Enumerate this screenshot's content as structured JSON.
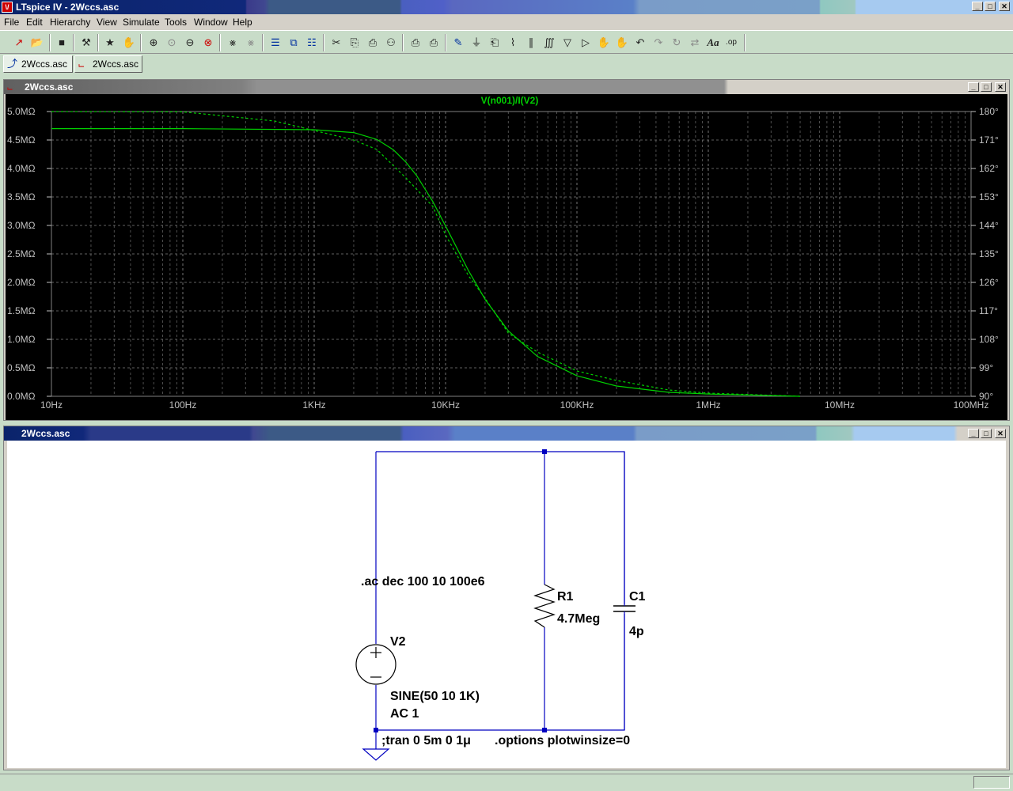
{
  "app": {
    "title": "LTspice IV - 2Wccs.asc",
    "icon_name": "ltspice-app-icon"
  },
  "menu": [
    "File",
    "Edit",
    "Hierarchy",
    "View",
    "Simulate",
    "Tools",
    "Window",
    "Help"
  ],
  "toolbar_icons": [
    "new-schematic-icon",
    "open-icon",
    "save-icon",
    "control-panel-icon",
    "run-icon",
    "halt-icon",
    "zoom-in-icon",
    "pan-icon",
    "zoom-out-icon",
    "zoom-fit-icon",
    "autorange-icon",
    "grid-icon",
    "tile-horizontal-icon",
    "cascade-icon",
    "tile-vertical-icon",
    "cut-icon",
    "copy-icon",
    "paste-icon",
    "find-icon",
    "print-setup-icon",
    "print-icon",
    "wire-icon",
    "ground-icon",
    "label-net-icon",
    "resistor-icon",
    "capacitor-icon",
    "inductor-icon",
    "diode-icon",
    "component-icon",
    "move-icon",
    "drag-icon",
    "undo-icon",
    "redo-icon",
    "rotate-icon",
    "mirror-icon",
    "text-icon",
    "spice-directive-icon"
  ],
  "tabs": [
    {
      "label": "2Wccs.asc",
      "icon": "schematic-icon"
    },
    {
      "label": "2Wccs.asc",
      "icon": "waveform-icon"
    }
  ],
  "plot_window": {
    "title": "2Wccs.asc",
    "trace_label": "V(n001)/I(V2)"
  },
  "schematic_window": {
    "title": "2Wccs.asc",
    "ac_directive": ".ac dec 100 10 100e6",
    "tran_directive": ";tran 0 5m 0 1μ",
    "options_directive": ".options plotwinsize=0",
    "r1_name": "R1",
    "r1_value": "4.7Meg",
    "c1_name": "C1",
    "c1_value": "4p",
    "v2_name": "V2",
    "v2_value1": "SINE(50 10 1K)",
    "v2_value2": "AC 1"
  },
  "colors": {
    "trace": "#00d000",
    "grid": "#808080",
    "wire": "#0000c0",
    "axis_text": "#c0c0c0",
    "plot_bg": "#000000"
  },
  "chart_data": {
    "type": "line",
    "title": "V(n001)/I(V2)",
    "x_scale": "log",
    "xlim": [
      10,
      100000000
    ],
    "x_tick_labels": [
      "10Hz",
      "100Hz",
      "1KHz",
      "10KHz",
      "100KHz",
      "1MHz",
      "10MHz",
      "100MHz"
    ],
    "x_tick_values": [
      10,
      100,
      1000,
      10000,
      100000,
      1000000,
      10000000,
      100000000
    ],
    "ylim_left": [
      0,
      5.0
    ],
    "y_left_tick_labels": [
      "0.0MΩ",
      "0.5MΩ",
      "1.0MΩ",
      "1.5MΩ",
      "2.0MΩ",
      "2.5MΩ",
      "3.0MΩ",
      "3.5MΩ",
      "4.0MΩ",
      "4.5MΩ",
      "5.0MΩ"
    ],
    "y_left_tick_values": [
      0,
      0.5,
      1.0,
      1.5,
      2.0,
      2.5,
      3.0,
      3.5,
      4.0,
      4.5,
      5.0
    ],
    "ylim_right": [
      90,
      180
    ],
    "y_right_tick_labels": [
      "90°",
      "99°",
      "108°",
      "117°",
      "126°",
      "135°",
      "144°",
      "153°",
      "162°",
      "171°",
      "180°"
    ],
    "y_right_tick_values": [
      90,
      99,
      108,
      117,
      126,
      135,
      144,
      153,
      162,
      171,
      180
    ],
    "grid": true,
    "series": [
      {
        "style": "solid",
        "axis": "left",
        "x": [
          10,
          100,
          1000,
          2000,
          3000,
          4000,
          5000,
          6000,
          8000,
          10000,
          15000,
          20000,
          30000,
          50000,
          100000,
          200000,
          500000,
          1000000,
          5000000
        ],
        "y": [
          4.7,
          4.7,
          4.68,
          4.63,
          4.51,
          4.33,
          4.11,
          3.88,
          3.42,
          2.99,
          2.2,
          1.7,
          1.15,
          0.7,
          0.36,
          0.18,
          0.07,
          0.04,
          0.0
        ]
      },
      {
        "style": "dashed",
        "axis": "right",
        "x": [
          10,
          100,
          500,
          1000,
          2000,
          3000,
          5000,
          8000,
          10000,
          15000,
          20000,
          30000,
          50000,
          100000,
          200000,
          500000,
          1000000,
          5000000
        ],
        "y": [
          180,
          179.9,
          177,
          174,
          171,
          168,
          159,
          150,
          141,
          128,
          121,
          110,
          104,
          98,
          95,
          92,
          91,
          90
        ]
      }
    ]
  }
}
